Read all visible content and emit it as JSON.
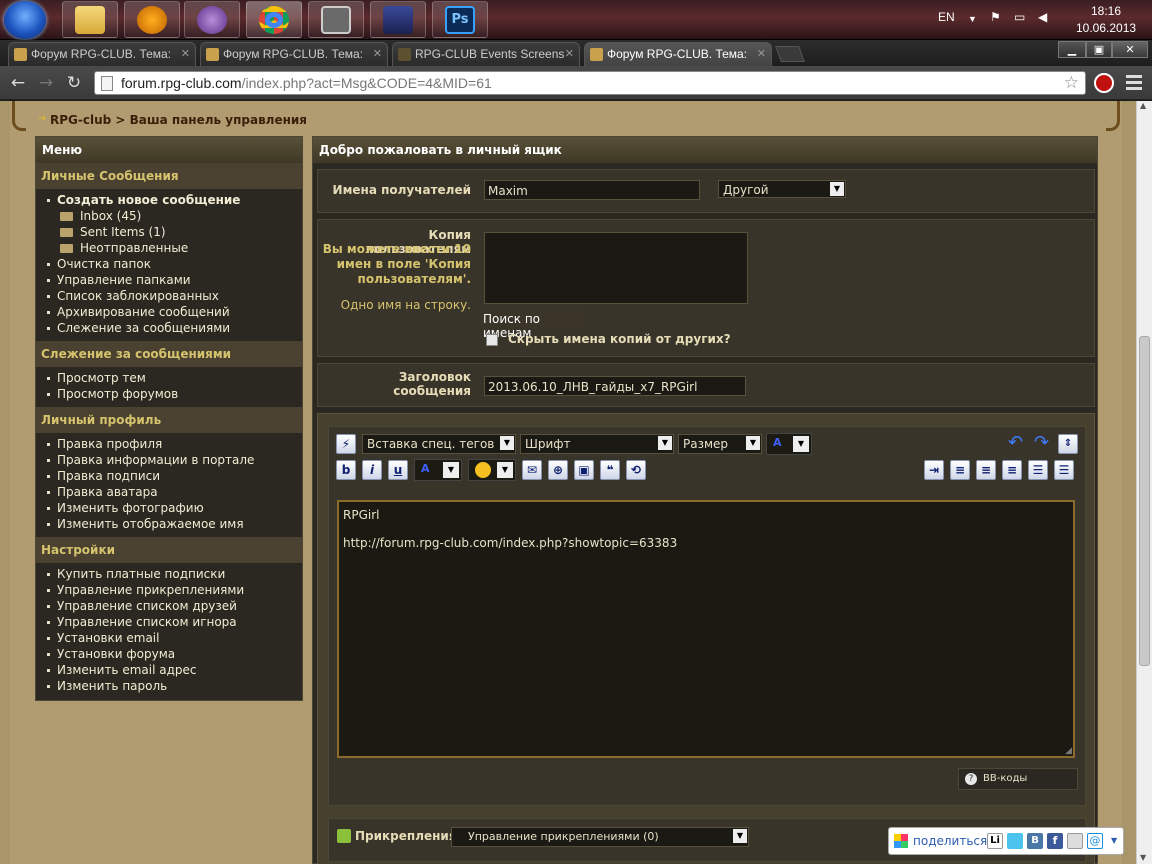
{
  "taskbar": {
    "clock_time": "18:16",
    "clock_date": "10.06.2013",
    "lang": "EN"
  },
  "tabs": [
    {
      "label": "Форум RPG-CLUB. Тема:"
    },
    {
      "label": "Форум RPG-CLUB. Тема:"
    },
    {
      "label": "RPG-CLUB Events Screens"
    },
    {
      "label": "Форум RPG-CLUB. Тема:"
    }
  ],
  "address": {
    "host": "forum.rpg-club.com",
    "path": "/index.php?act=Msg&CODE=4&MID=61"
  },
  "breadcrumb": "RPG-club > Ваша панель управления",
  "sidebar": {
    "title": "Меню",
    "sections": [
      {
        "title": "Личные Сообщения",
        "items": [
          {
            "label": "Создать новое сообщение",
            "bold": true
          },
          {
            "label": "Inbox (45)",
            "sub": true
          },
          {
            "label": "Sent Items (1)",
            "sub": true
          },
          {
            "label": "Неотправленные",
            "sub": true
          },
          {
            "label": "Очистка папок"
          },
          {
            "label": "Управление папками"
          },
          {
            "label": "Список заблокированных"
          },
          {
            "label": "Архивирование сообщений"
          },
          {
            "label": "Слежение за сообщениями"
          }
        ]
      },
      {
        "title": "Слежение за сообщениями",
        "items": [
          {
            "label": "Просмотр тем"
          },
          {
            "label": "Просмотр форумов"
          }
        ]
      },
      {
        "title": "Личный профиль",
        "items": [
          {
            "label": "Правка профиля"
          },
          {
            "label": "Правка информации в портале"
          },
          {
            "label": "Правка подписи"
          },
          {
            "label": "Правка аватара"
          },
          {
            "label": "Изменить фотографию"
          },
          {
            "label": "Изменить отображаемое имя"
          }
        ]
      },
      {
        "title": "Настройки",
        "items": [
          {
            "label": "Купить платные подписки"
          },
          {
            "label": "Управление прикреплениями"
          },
          {
            "label": "Управление списком друзей"
          },
          {
            "label": "Управление списком игнора"
          },
          {
            "label": "Установки email"
          },
          {
            "label": "Установки форума"
          },
          {
            "label": "Изменить email адрес"
          },
          {
            "label": "Изменить пароль"
          }
        ]
      }
    ]
  },
  "form": {
    "title": "Добро пожаловать в личный ящик",
    "recipients_label": "Имена получателей",
    "recipients_value": "Maxim",
    "recipients_select": "Другой",
    "cc_label": "Копия пользователям",
    "cc_hint": "Вы можете ввести 10 имен в поле 'Копия пользователям'.",
    "cc_hint2": "Одно имя на строку.",
    "search_names": "Поиск по именам",
    "hide_cc_label": "Скрыть имена копий от других?",
    "subject_label": "Заголовок сообщения",
    "subject_value": "2013.06.10_ЛНВ_гайды_x7_RPGirl",
    "toolbar": {
      "special_tags": "Вставка спец. тегов",
      "font": "Шрифт",
      "size": "Размер"
    },
    "body_line1": "RPGirl",
    "body_line2": "http://forum.rpg-club.com/index.php?showtopic=63383",
    "bbcodes": "BB-коды",
    "attachments_label": "Прикрепления",
    "attachments_select": "Управление прикреплениями (0)",
    "share_label": "поделиться"
  }
}
